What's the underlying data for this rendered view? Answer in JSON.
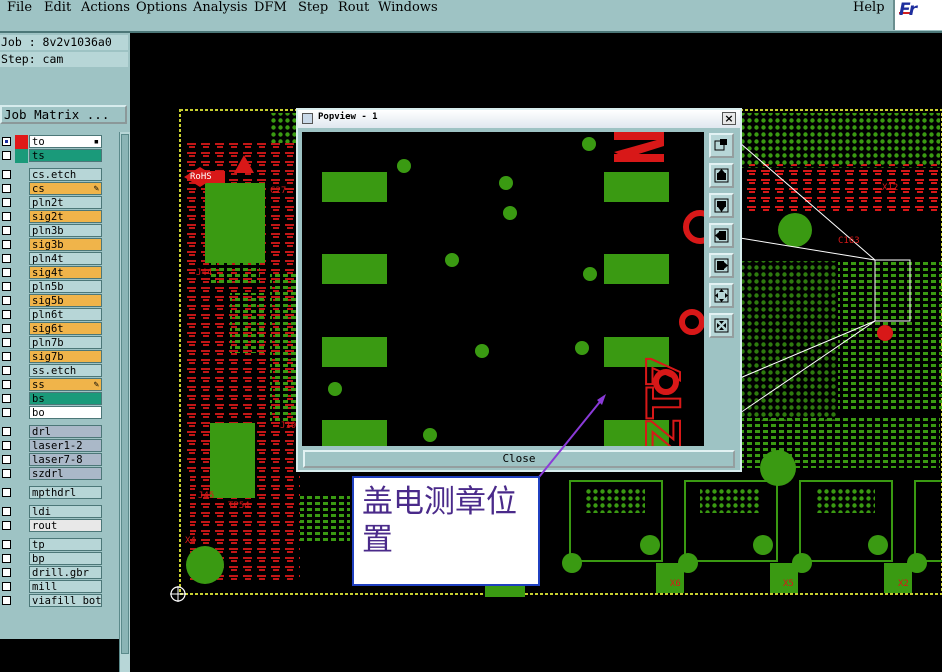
{
  "menubar": {
    "items": [
      {
        "id": "file",
        "label": "File"
      },
      {
        "id": "edit",
        "label": "Edit"
      },
      {
        "id": "actions",
        "label": "Actions"
      },
      {
        "id": "options",
        "label": "Options"
      },
      {
        "id": "analysis",
        "label": "Analysis"
      },
      {
        "id": "dfm",
        "label": "DFM"
      },
      {
        "id": "step",
        "label": "Step"
      },
      {
        "id": "rout",
        "label": "Rout"
      },
      {
        "id": "windows",
        "label": "Windows"
      }
    ],
    "help_label": "Help",
    "logo_text": "Fr"
  },
  "job_info": {
    "job": "Job : 8v2v1036a0",
    "step": "Step: cam",
    "matrix_button": "Job Matrix ..."
  },
  "layers": [
    {
      "name": "to",
      "color": "#ffffff",
      "mark": "▪",
      "cb2": "#e01818"
    },
    {
      "name": "ts",
      "color": "#1a9a7a",
      "mark": "",
      "cb2": "#1a9a7a"
    },
    {
      "name": "cs.etch",
      "color": "#b7d6d7",
      "mark": ""
    },
    {
      "name": "cs",
      "color": "#f0b44a",
      "mark": "✎"
    },
    {
      "name": "pln2t",
      "color": "#b7d6d7",
      "mark": ""
    },
    {
      "name": "sig2t",
      "color": "#f0b44a",
      "mark": ""
    },
    {
      "name": "pln3b",
      "color": "#b7d6d7",
      "mark": ""
    },
    {
      "name": "sig3b",
      "color": "#f0b44a",
      "mark": ""
    },
    {
      "name": "pln4t",
      "color": "#b7d6d7",
      "mark": ""
    },
    {
      "name": "sig4t",
      "color": "#f0b44a",
      "mark": ""
    },
    {
      "name": "pln5b",
      "color": "#b7d6d7",
      "mark": ""
    },
    {
      "name": "sig5b",
      "color": "#f0b44a",
      "mark": ""
    },
    {
      "name": "pln6t",
      "color": "#b7d6d7",
      "mark": ""
    },
    {
      "name": "sig6t",
      "color": "#f0b44a",
      "mark": ""
    },
    {
      "name": "pln7b",
      "color": "#b7d6d7",
      "mark": ""
    },
    {
      "name": "sig7b",
      "color": "#f0b44a",
      "mark": ""
    },
    {
      "name": "ss.etch",
      "color": "#b7d6d7",
      "mark": ""
    },
    {
      "name": "ss",
      "color": "#f0b44a",
      "mark": "✎"
    },
    {
      "name": "bs",
      "color": "#1a9a7a",
      "mark": ""
    },
    {
      "name": "bo",
      "color": "#ffffff",
      "mark": ""
    },
    {
      "name": "drl",
      "color": "#aab8c8",
      "mark": ""
    },
    {
      "name": "laser1-2",
      "color": "#aab8c8",
      "mark": ""
    },
    {
      "name": "laser7-8",
      "color": "#aab8c8",
      "mark": ""
    },
    {
      "name": "szdrl",
      "color": "#aab8c8",
      "mark": ""
    },
    {
      "name": "mpthdrl",
      "color": "#b7d6d7",
      "mark": ""
    },
    {
      "name": "ldi",
      "color": "#b7d6d7",
      "mark": ""
    },
    {
      "name": "rout",
      "color": "#e8e8e8",
      "mark": ""
    },
    {
      "name": "tp",
      "color": "#b7d6d7",
      "mark": ""
    },
    {
      "name": "bp",
      "color": "#b7d6d7",
      "mark": ""
    },
    {
      "name": "drill.gbr",
      "color": "#b7d6d7",
      "mark": ""
    },
    {
      "name": "mill",
      "color": "#b7d6d7",
      "mark": ""
    },
    {
      "name": "viafill_bot",
      "color": "#b7d6d7",
      "mark": ""
    }
  ],
  "board_labels": [
    {
      "text": "RoHS"
    },
    {
      "text": "C27"
    },
    {
      "text": "J44"
    },
    {
      "text": "J45"
    },
    {
      "text": "X4"
    },
    {
      "text": "X12"
    },
    {
      "text": "X6"
    },
    {
      "text": "X5"
    },
    {
      "text": "X2"
    },
    {
      "text": "J19"
    },
    {
      "text": "TP54"
    },
    {
      "text": "C163"
    }
  ],
  "popview": {
    "title": "Popview - 1",
    "close_label": "Close",
    "zoom_text": "ZT7",
    "tools": [
      {
        "id": "fit",
        "icon": "zoom-fit-icon"
      },
      {
        "id": "up",
        "icon": "pan-up-icon"
      },
      {
        "id": "down",
        "icon": "pan-down-icon"
      },
      {
        "id": "left",
        "icon": "pan-left-icon"
      },
      {
        "id": "right",
        "icon": "pan-right-icon"
      },
      {
        "id": "zoomin",
        "icon": "zoom-in-icon"
      },
      {
        "id": "zoomout",
        "icon": "zoom-out-icon"
      }
    ]
  },
  "annotation": {
    "text": "盖电测章位置"
  },
  "colors": {
    "panel_bg": "#9ec3c4",
    "board_green": "#3a9a12",
    "board_red": "#e01818",
    "annotation_border": "#2040c0",
    "arrow": "#8a3ad8"
  }
}
